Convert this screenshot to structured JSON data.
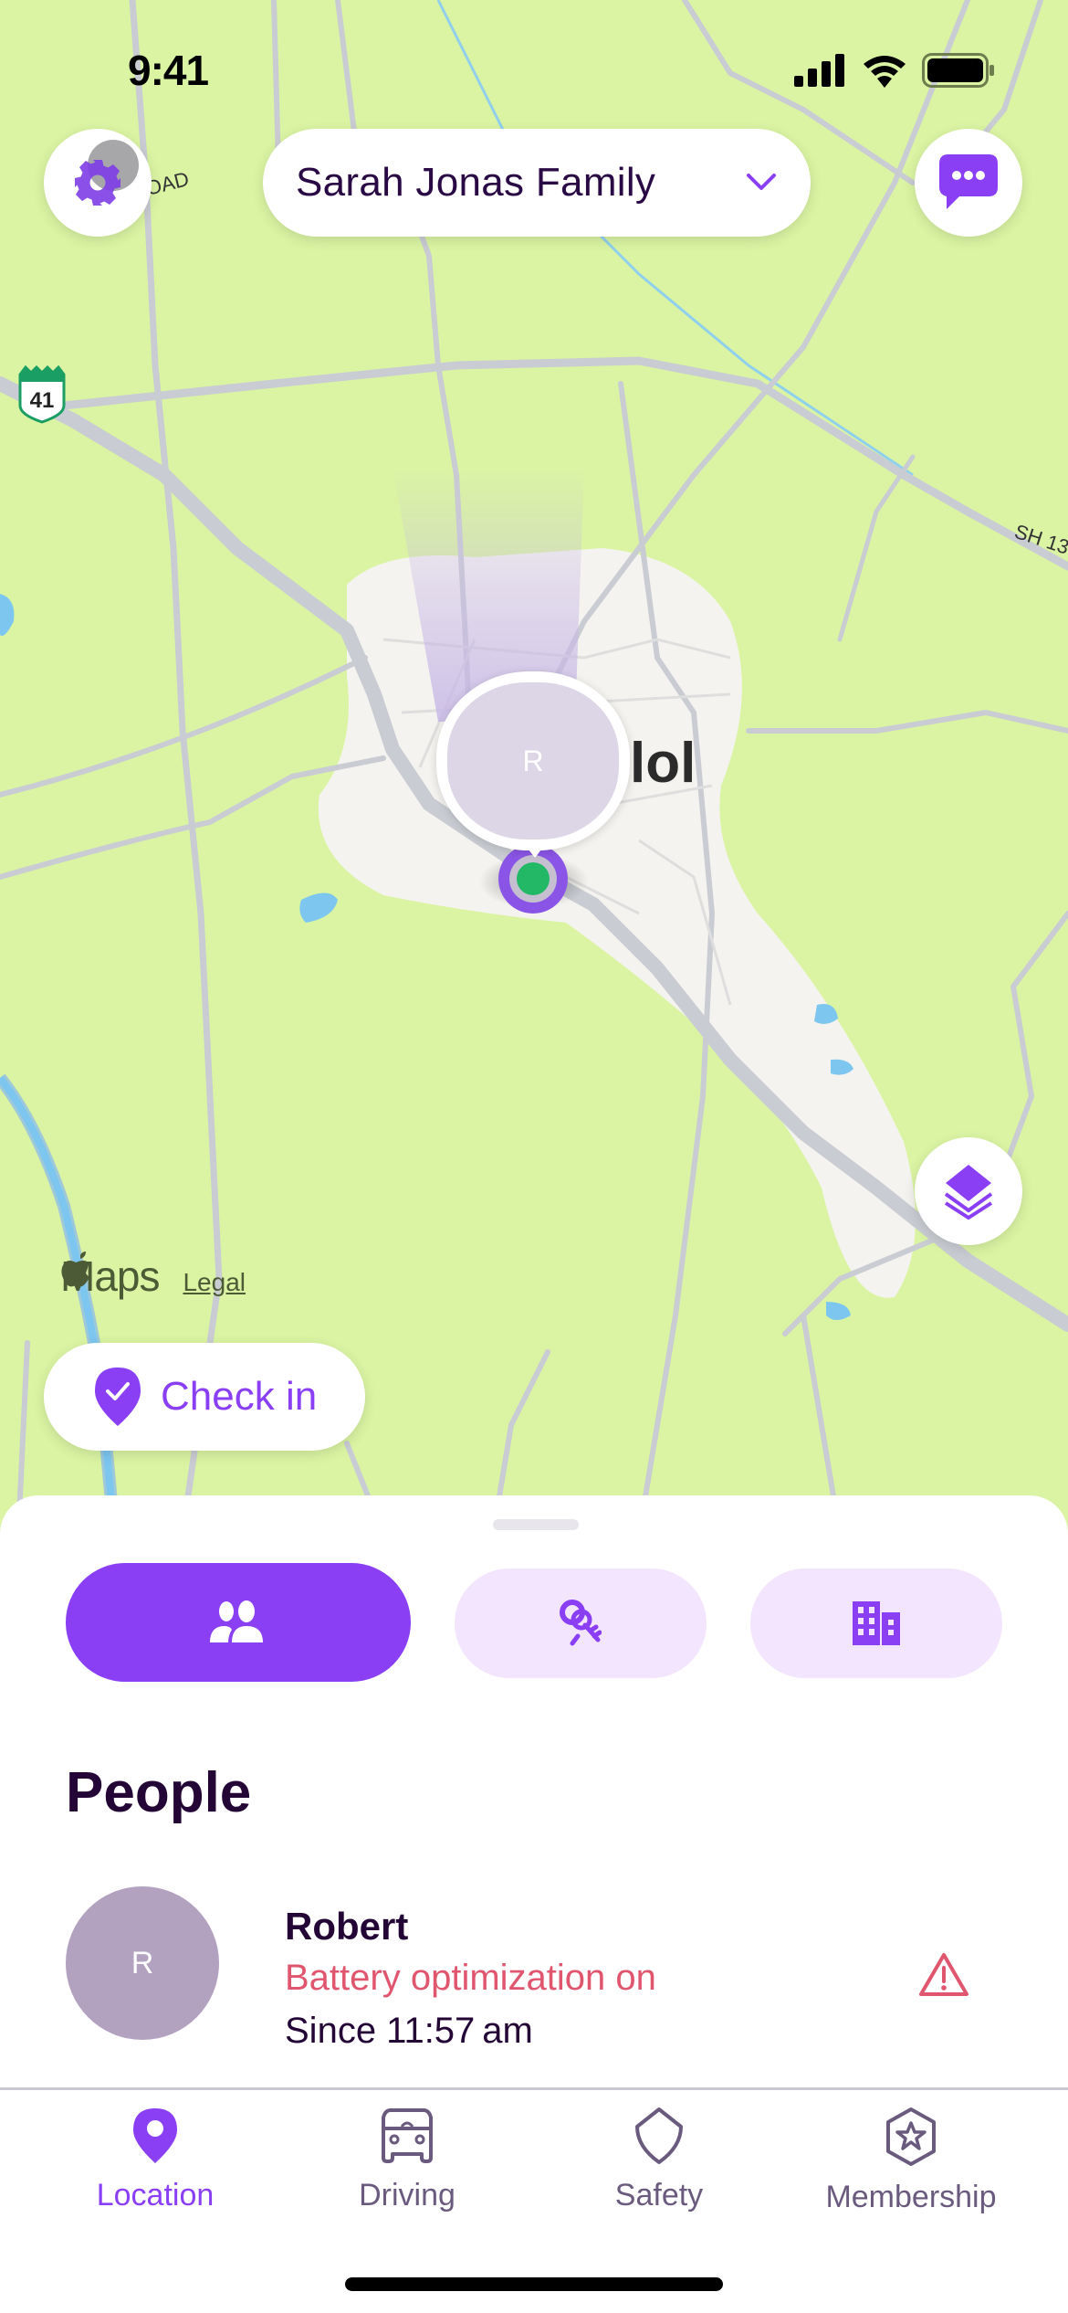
{
  "status_bar": {
    "time": "9:41",
    "signal_icon": "cellular-signal-icon",
    "wifi_icon": "wifi-icon",
    "battery_icon": "battery-icon"
  },
  "header": {
    "settings_icon": "gear-icon",
    "circle_name": "Sarah Jonas Family",
    "dropdown_icon": "chevron-down-icon",
    "chat_icon": "chat-bubble-icon"
  },
  "map": {
    "city_label": "lol",
    "road_labels": {
      "highway_shield": "41",
      "road_top_left": "OAD",
      "road_right": "SH 13"
    },
    "member_pin": {
      "initial": "R"
    },
    "attribution": {
      "brand": "Maps",
      "legal": "Legal"
    },
    "layers_icon": "layers-icon"
  },
  "checkin": {
    "label": "Check in",
    "icon": "location-check-icon"
  },
  "sheet": {
    "segments": [
      {
        "name": "people",
        "icon": "people-icon",
        "selected": true
      },
      {
        "name": "items",
        "icon": "keys-icon",
        "selected": false
      },
      {
        "name": "places",
        "icon": "building-icon",
        "selected": false
      }
    ],
    "section_title": "People",
    "people": [
      {
        "initial": "R",
        "name": "Robert",
        "status": "Battery optimization on",
        "since": "Since 11:57 am",
        "alert_icon": "warning-triangle-icon"
      }
    ]
  },
  "tabbar": {
    "tabs": [
      {
        "label": "Location",
        "icon": "location-pin-icon",
        "active": true
      },
      {
        "label": "Driving",
        "icon": "car-icon",
        "active": false
      },
      {
        "label": "Safety",
        "icon": "shield-icon",
        "active": false
      },
      {
        "label": "Membership",
        "icon": "membership-star-icon",
        "active": false
      }
    ]
  },
  "colors": {
    "accent": "#8a3ff5",
    "accent_light": "#f3e5fd",
    "text_dark": "#230536",
    "alert": "#e0566f",
    "map_land": "#daf4a3"
  }
}
